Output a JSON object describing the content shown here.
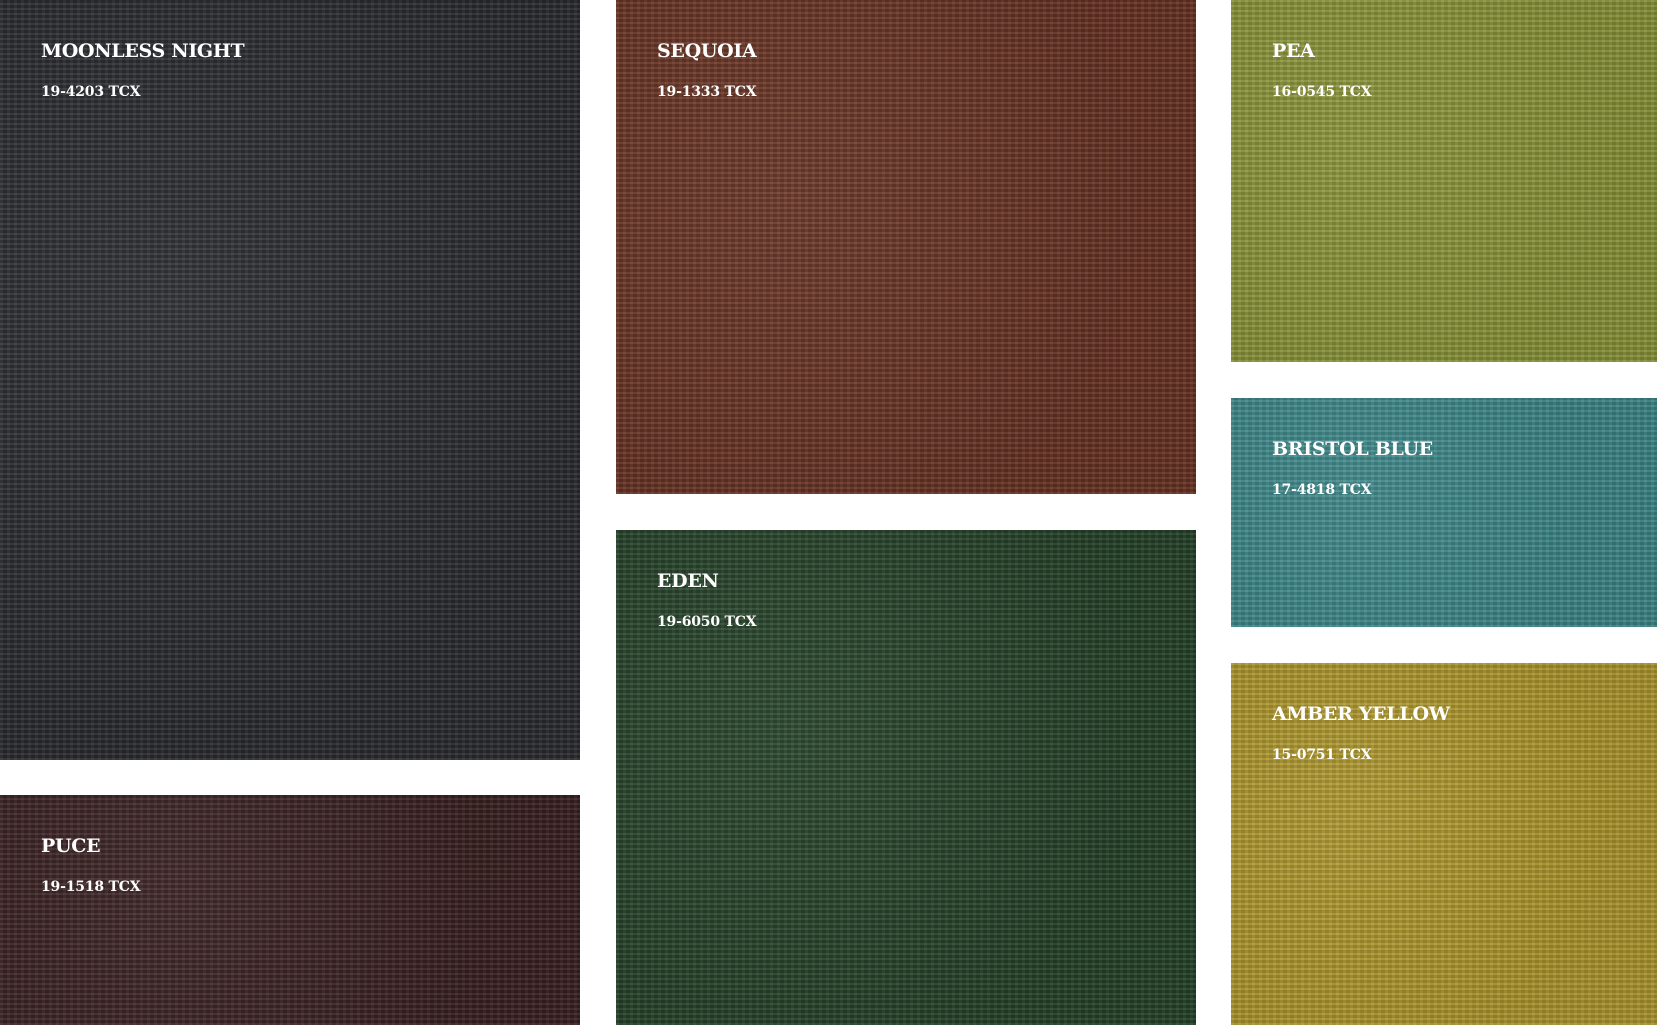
{
  "swatches": [
    {
      "id": "moonless",
      "name": "MOONLESS NIGHT",
      "code": "19-4203 TCX",
      "color": "#2c2d31"
    },
    {
      "id": "puce",
      "name": "PUCE",
      "code": "19-1518 TCX",
      "color": "#3b2223"
    },
    {
      "id": "sequoia",
      "name": "SEQUOIA",
      "code": "19-1333 TCX",
      "color": "#6a3424"
    },
    {
      "id": "eden",
      "name": "EDEN",
      "code": "19-6050 TCX",
      "color": "#26442a"
    },
    {
      "id": "pea",
      "name": "PEA",
      "code": "16-0545 TCX",
      "color": "#8c973a"
    },
    {
      "id": "bristol",
      "name": "BRISTOL BLUE",
      "code": "17-4818 TCX",
      "color": "#3e8a8c"
    },
    {
      "id": "amber",
      "name": "AMBER YELLOW",
      "code": "15-0751 TCX",
      "color": "#b19a2e"
    }
  ]
}
